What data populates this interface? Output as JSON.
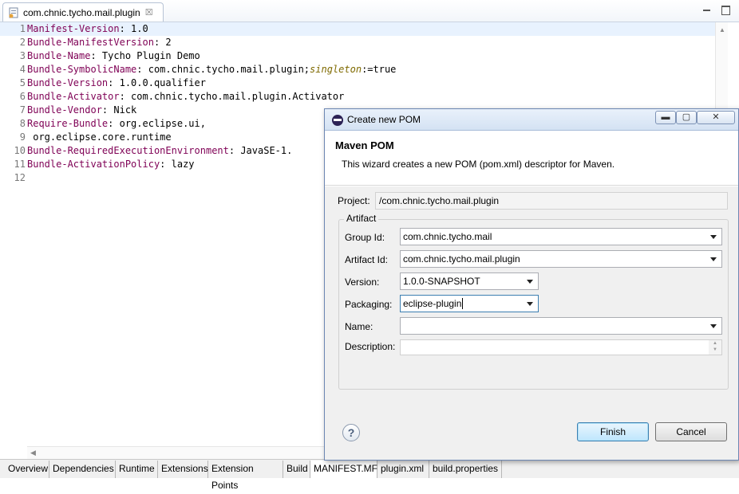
{
  "editor_tab": {
    "label": "com.chnic.tycho.mail.plugin",
    "close": "☒"
  },
  "editor": {
    "lines": [
      {
        "n": "1",
        "key": "Manifest-Version",
        "rest": ": 1.0"
      },
      {
        "n": "2",
        "key": "Bundle-ManifestVersion",
        "rest": ": 2"
      },
      {
        "n": "3",
        "key": "Bundle-Name",
        "rest": ": Tycho Plugin Demo"
      },
      {
        "n": "4",
        "key": "Bundle-SymbolicName",
        "rest": ": com.chnic.tycho.mail.plugin;",
        "attr": "singleton",
        "attr_rest": ":=true"
      },
      {
        "n": "5",
        "key": "Bundle-Version",
        "rest": ": 1.0.0.qualifier"
      },
      {
        "n": "6",
        "key": "Bundle-Activator",
        "rest": ": com.chnic.tycho.mail.plugin.Activator"
      },
      {
        "n": "7",
        "key": "Bundle-Vendor",
        "rest": ": Nick"
      },
      {
        "n": "8",
        "key": "Require-Bundle",
        "rest": ": org.eclipse.ui,"
      },
      {
        "n": "9",
        "key": "",
        "rest": " org.eclipse.core.runtime"
      },
      {
        "n": "10",
        "key": "Bundle-RequiredExecutionEnvironment",
        "rest": ": JavaSE-1."
      },
      {
        "n": "11",
        "key": "Bundle-ActivationPolicy",
        "rest": ": lazy"
      },
      {
        "n": "12",
        "key": "",
        "rest": ""
      }
    ]
  },
  "page_tabs": [
    "Overview",
    "Dependencies",
    "Runtime",
    "Extensions",
    "Extension Points",
    "Build",
    "MANIFEST.MF",
    "plugin.xml",
    "build.properties"
  ],
  "active_page_tab": "MANIFEST.MF",
  "dialog": {
    "title": "Create new POM",
    "banner_title": "Maven POM",
    "banner_desc": "This wizard creates a new POM (pom.xml) descriptor for Maven.",
    "project_label": "Project:",
    "project_value": "/com.chnic.tycho.mail.plugin",
    "group_label": "Artifact",
    "group_id_label": "Group Id:",
    "group_id_value": "com.chnic.tycho.mail",
    "artifact_id_label": "Artifact Id:",
    "artifact_id_value": "com.chnic.tycho.mail.plugin",
    "version_label": "Version:",
    "version_value": "1.0.0-SNAPSHOT",
    "packaging_label": "Packaging:",
    "packaging_value": "eclipse-plugin",
    "name_label": "Name:",
    "name_value": "",
    "description_label": "Description:",
    "description_value": "",
    "help_label": "?",
    "finish_label": "Finish",
    "cancel_label": "Cancel"
  },
  "colors": {
    "keyword": "#7f0055",
    "attribute": "#7f6a00",
    "current_line": "#e8f2fe"
  }
}
